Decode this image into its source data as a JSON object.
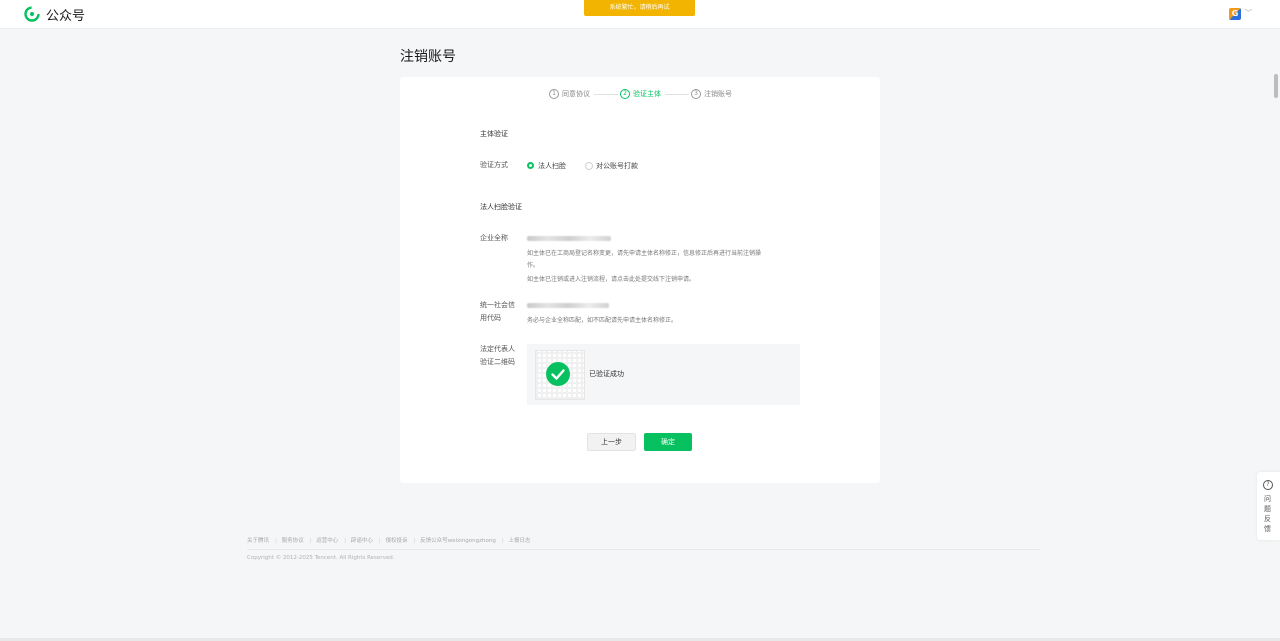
{
  "header": {
    "brand": "公众号",
    "notice": "系统繁忙，请稍后再试",
    "account_icon": "account-avatar-icon"
  },
  "page": {
    "title": "注销账号"
  },
  "steps": [
    {
      "num": "1",
      "label": "同意协议"
    },
    {
      "num": "2",
      "label": "验证主体"
    },
    {
      "num": "3",
      "label": "注销账号"
    }
  ],
  "form": {
    "section_main": "主体验证",
    "method_label": "验证方式",
    "method_option_1": "法人扫脸",
    "method_option_2": "对公账号打款",
    "section_face": "法人扫脸验证",
    "company_label": "企业全称",
    "company_hint_1": "如主体已在工商局登记名称变更，请先申请主体名称修正，信息修正后再进行当前注销操",
    "company_hint_1b": "作。",
    "company_hint_2": "如主体已注销或进入注销流程，请点击此处提交线下注销申请。",
    "credit_label_1": "统一社会信",
    "credit_label_2": "用代码",
    "credit_hint": "务必与企业全称匹配，如不匹配请先申请主体名称修正。",
    "scan_label_1": "法定代表人",
    "scan_label_2": "验证二维码",
    "scan_status": "已验证成功"
  },
  "buttons": {
    "prev": "上一步",
    "confirm": "确定"
  },
  "footer": {
    "links": [
      "关于腾讯",
      "服务协议",
      "运营中心",
      "辟谣中心",
      "侵权投诉",
      "反馈公众号weixingongzhong",
      "上报日志"
    ],
    "copyright": "Copyright © 2012-2025 Tencent. All Rights Reserved."
  },
  "feedback": {
    "label": "问题反馈"
  },
  "colors": {
    "accent": "#07c160",
    "notice": "#f2b400"
  }
}
